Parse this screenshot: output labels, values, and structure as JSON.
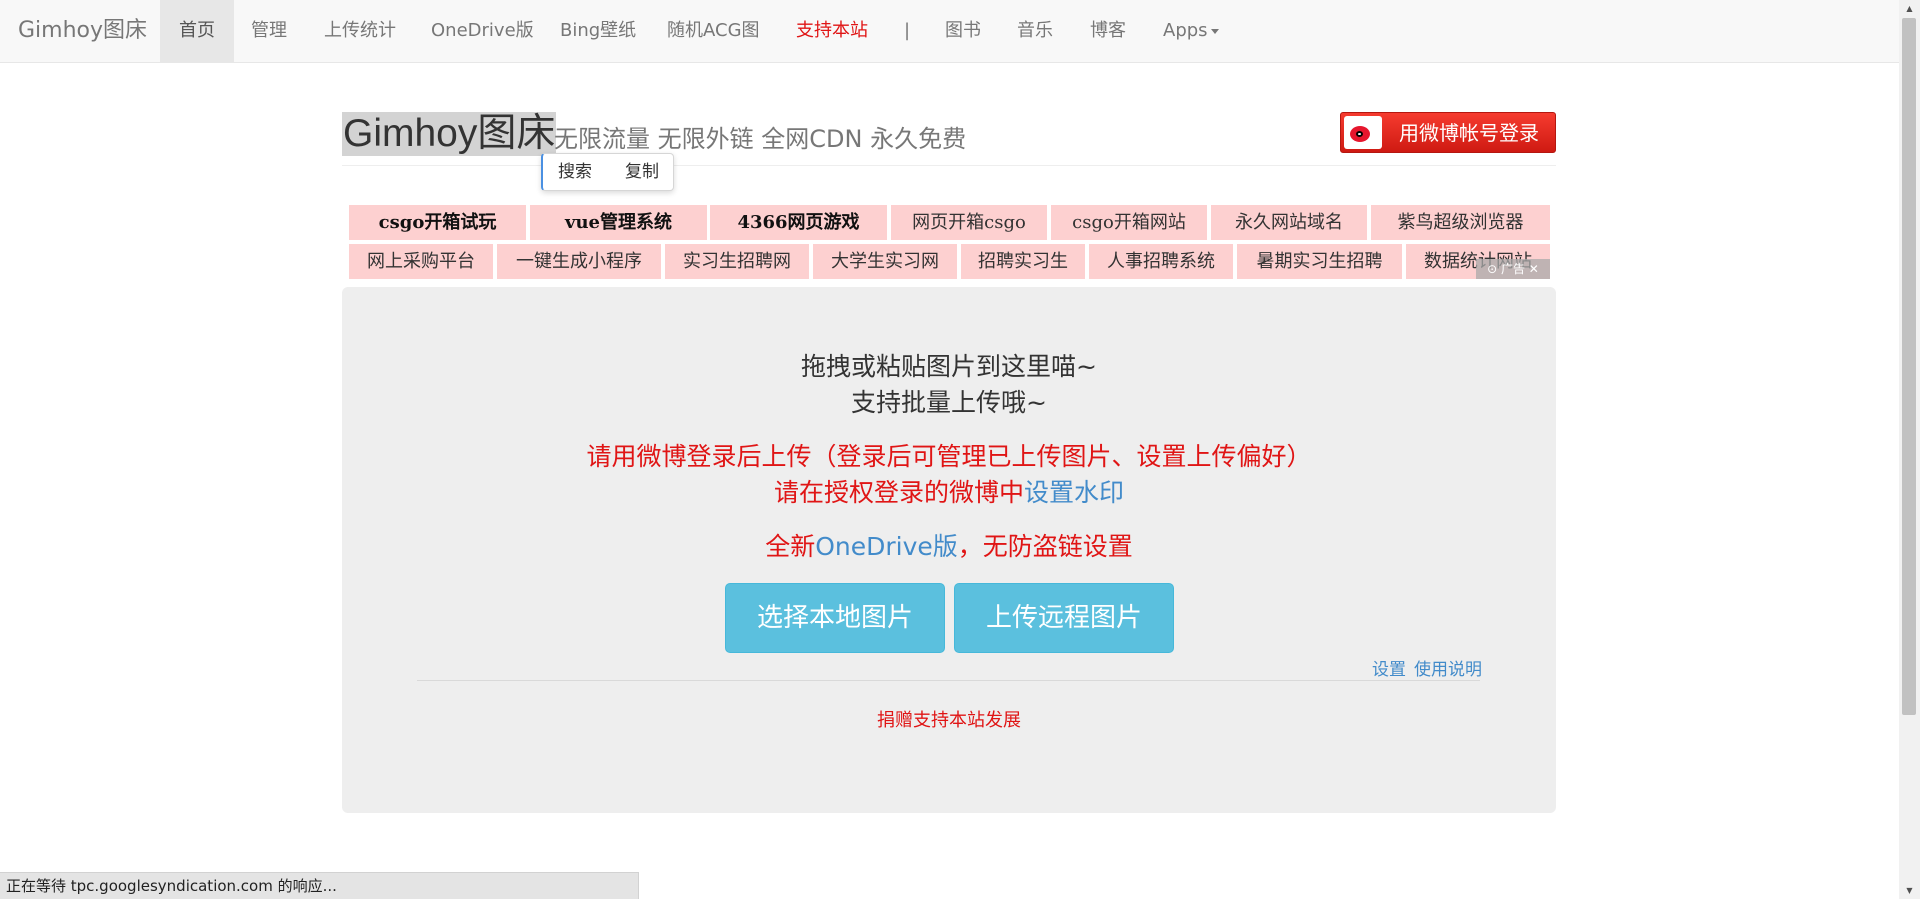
{
  "navbar": {
    "brand": "Gimhoy图床",
    "items": [
      {
        "label": "首页"
      },
      {
        "label": "管理"
      },
      {
        "label": "上传统计"
      },
      {
        "label": "OneDrive版"
      },
      {
        "label": "Bing壁纸"
      },
      {
        "label": "随机ACG图"
      },
      {
        "label": "支持本站"
      },
      {
        "label": "|"
      },
      {
        "label": "图书"
      },
      {
        "label": "音乐"
      },
      {
        "label": "博客"
      },
      {
        "label": "Apps"
      }
    ]
  },
  "header": {
    "title": "Gimhoy图床",
    "subtitle": "无限流量 无限外链 全网CDN 永久免费",
    "weibo_login": "用微博帐号登录"
  },
  "context_menu": {
    "search": "搜索",
    "copy": "复制"
  },
  "ads": {
    "row1": [
      "csgo开箱试玩",
      "vue管理系统",
      "4366网页游戏",
      "网页开箱csgo",
      "csgo开箱网站",
      "永久网站域名",
      "紫鸟超级浏览器"
    ],
    "row2": [
      "网上采购平台",
      "一键生成小程序",
      "实习生招聘网",
      "大学生实习网",
      "招聘实习生",
      "人事招聘系统",
      "暑期实习生招聘",
      "数据统计网站"
    ],
    "mark": "⊙ 广告 ✕"
  },
  "upload": {
    "drop_line1": "拖拽或粘贴图片到这里喵~",
    "drop_line2": "支持批量上传哦~",
    "login_notice": "请用微博登录后上传（登录后可管理已上传图片、设置上传偏好）",
    "watermark_prefix": "请在授权登录的微博中",
    "watermark_link": "设置水印",
    "onedrive_prefix": "全新",
    "onedrive_link": "OneDrive版",
    "onedrive_suffix": "，无防盗链设置",
    "select_local": "选择本地图片",
    "upload_remote": "上传远程图片",
    "settings_link": "设置",
    "help_link": "使用说明",
    "donate": "捐赠支持本站发展"
  },
  "status_bar": "正在等待 tpc.googlesyndication.com 的响应...",
  "colors": {
    "accent_red": "#e01515",
    "link_blue": "#428bca",
    "button_info": "#5bc0de",
    "ad_bg": "#fdd0d0"
  }
}
